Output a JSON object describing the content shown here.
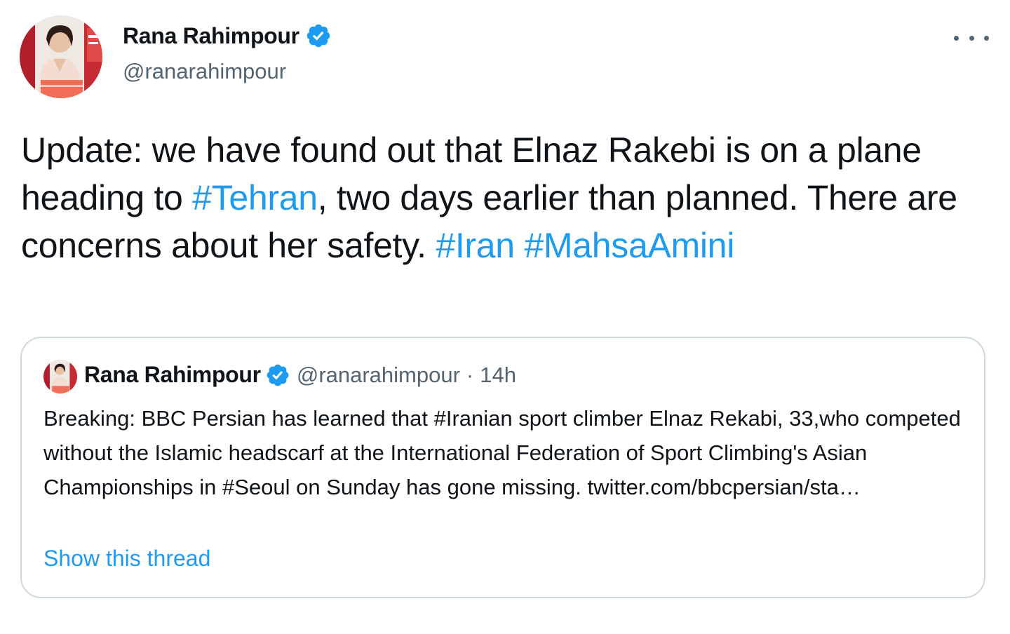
{
  "tweet": {
    "author_name": "Rana Rahimpour",
    "author_handle": "@ranarahimpour",
    "verified_icon": "verified-badge-icon",
    "more_icon": "more-options-icon",
    "text_segments": [
      {
        "text": "Update: we have found out that Elnaz Rakebi is on a plane heading to ",
        "hashtag": false
      },
      {
        "text": "#Tehran",
        "hashtag": true
      },
      {
        "text": ", two days earlier than planned. There are concerns about her safety. ",
        "hashtag": false
      },
      {
        "text": "#Iran",
        "hashtag": true
      },
      {
        "text": " ",
        "hashtag": false
      },
      {
        "text": "#MahsaAmini",
        "hashtag": true
      }
    ]
  },
  "quoted_tweet": {
    "author_name": "Rana Rahimpour",
    "author_handle": "@ranarahimpour",
    "separator": "·",
    "time": "14h",
    "text": "Breaking: BBC Persian has learned that #Iranian sport climber Elnaz Rekabi, 33,who competed without the Islamic headscarf at the International Federation of Sport Climbing's Asian Championships in #Seoul on Sunday has gone missing. twitter.com/bbcpersian/sta…",
    "show_thread_label": "Show this thread"
  },
  "colors": {
    "link": "#1d9bf0",
    "secondary_text": "#536471",
    "border": "#cfd9de",
    "verified": "#1d9bf0"
  }
}
